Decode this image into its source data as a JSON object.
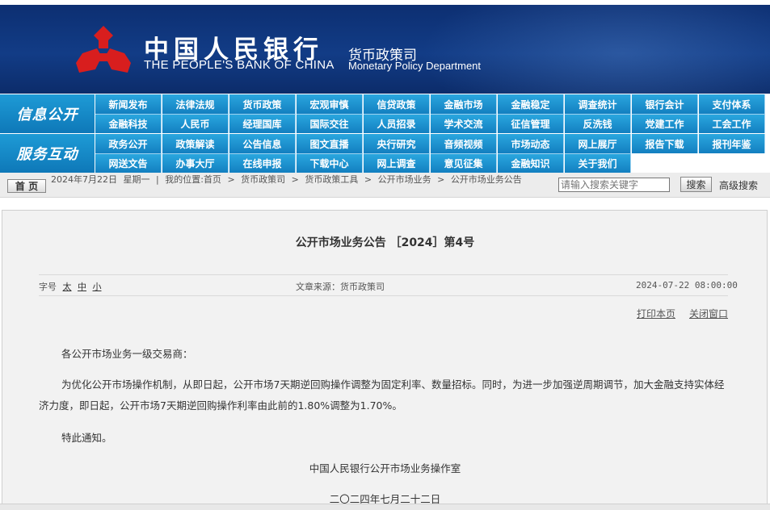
{
  "header": {
    "bank_name_cn": "中国人民银行",
    "bank_name_en": "THE PEOPLE'S BANK OF CHINA",
    "dept_cn": "货币政策司",
    "dept_en": "Monetary Policy Department",
    "banner_color": "#0d2f72",
    "logo_color": "#d81e1e"
  },
  "nav": {
    "section1_label": "信息公开",
    "section2_label": "服务互动",
    "row1": [
      "新闻发布",
      "法律法规",
      "货币政策",
      "宏观审慎",
      "信贷政策",
      "金融市场",
      "金融稳定",
      "调查统计",
      "银行会计",
      "支付体系"
    ],
    "row2": [
      "金融科技",
      "人民币",
      "经理国库",
      "国际交往",
      "人员招录",
      "学术交流",
      "征信管理",
      "反洗钱",
      "党建工作",
      "工会工作"
    ],
    "row3": [
      "政务公开",
      "政策解读",
      "公告信息",
      "图文直播",
      "央行研究",
      "音频视频",
      "市场动态",
      "网上展厅",
      "报告下载",
      "报刊年鉴"
    ],
    "row4": [
      "网送文告",
      "办事大厅",
      "在线申报",
      "下载中心",
      "网上调查",
      "意见征集",
      "金融知识",
      "关于我们"
    ],
    "color": "#1a8fcf"
  },
  "crumb": {
    "home_label": "首 页",
    "date": "2024年7月22日",
    "weekday": "星期一",
    "location_prefix": "我的位置:",
    "items": [
      "首页",
      "货币政策司",
      "货币政策工具",
      "公开市场业务",
      "公开市场业务公告"
    ],
    "separator": ">",
    "divider": "|"
  },
  "search": {
    "placeholder": "请输入搜索关键字",
    "button_label": "搜索",
    "advanced_label": "高级搜索"
  },
  "article": {
    "title": "公开市场业务公告 ［2024］第4号",
    "font_size_label": "字号",
    "font_sizes": [
      "太",
      "中",
      "小"
    ],
    "source": "文章来源：货币政策司",
    "datetime": "2024-07-22 08:00:00",
    "print_label": "打印本页",
    "close_label": "关闭窗口",
    "salutation": "各公开市场业务一级交易商：",
    "body": "为优化公开市场操作机制，从即日起，公开市场7天期逆回购操作调整为固定利率、数量招标。同时，为进一步加强逆周期调节，加大金融支持实体经济力度，即日起，公开市场7天期逆回购操作利率由此前的1.80%调整为1.70%。",
    "notice": "特此通知。",
    "signature": "中国人民银行公开市场业务操作室",
    "sign_date": "二〇二四年七月二十二日"
  }
}
